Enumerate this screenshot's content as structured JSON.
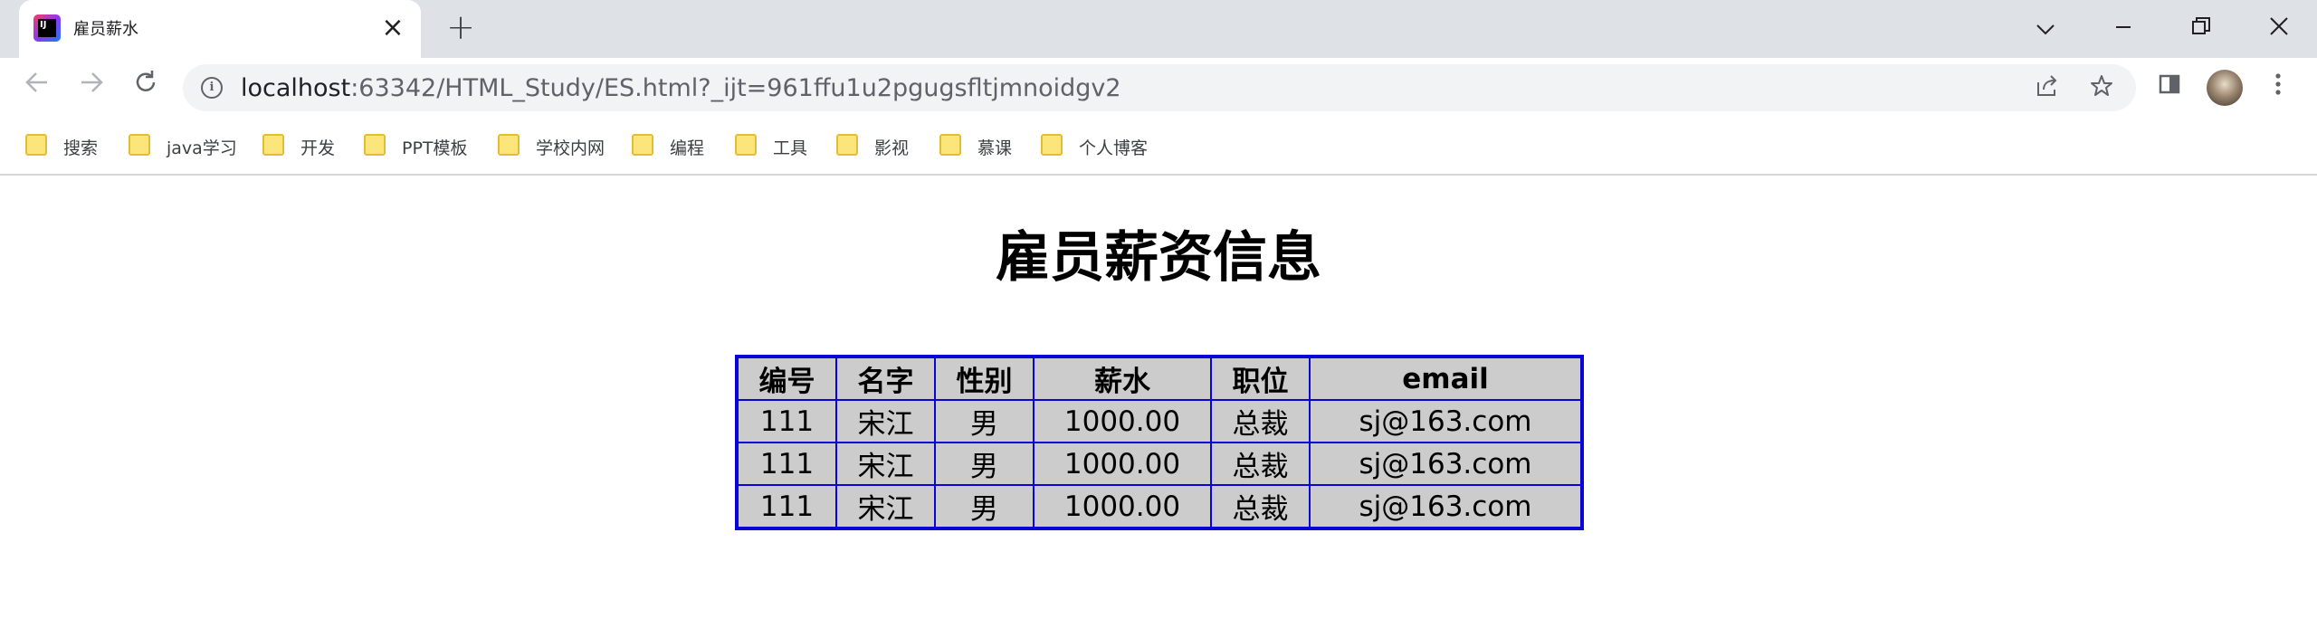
{
  "browser": {
    "tab_title": "雇员薪水",
    "url_host": "localhost",
    "url_rest": ":63342/HTML_Study/ES.html?_ijt=961ffu1u2pgugsfltjmnoidgv2"
  },
  "bookmarks": [
    "搜索",
    "java学习",
    "开发",
    "PPT模板",
    "学校内网",
    "编程",
    "工具",
    "影视",
    "慕课",
    "个人博客"
  ],
  "page": {
    "title": "雇员薪资信息",
    "table": {
      "headers": [
        "编号",
        "名字",
        "性别",
        "薪水",
        "职位",
        "email"
      ],
      "rows": [
        [
          "111",
          "宋江",
          "男",
          "1000.00",
          "总裁",
          "sj@163.com"
        ],
        [
          "111",
          "宋江",
          "男",
          "1000.00",
          "总裁",
          "sj@163.com"
        ],
        [
          "111",
          "宋江",
          "男",
          "1000.00",
          "总裁",
          "sj@163.com"
        ]
      ]
    }
  },
  "colors": {
    "table_border": "#0a05d6",
    "table_background": "#cccccc"
  }
}
